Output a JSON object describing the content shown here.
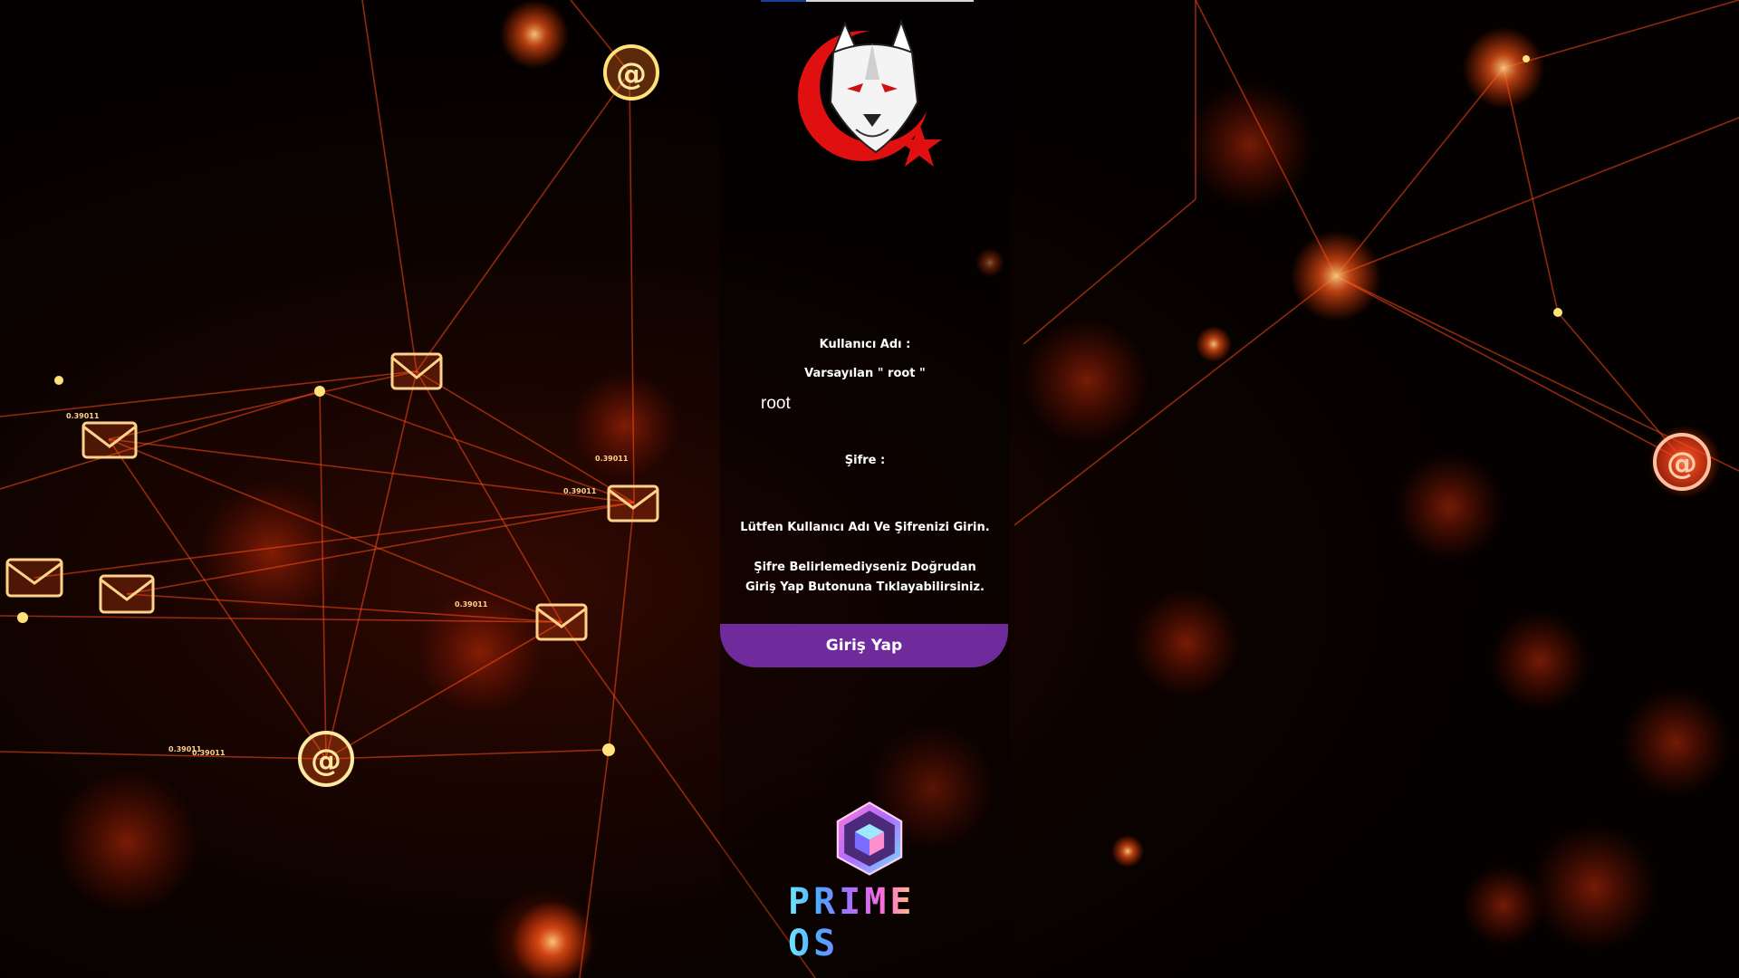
{
  "login": {
    "username_label": "Kullanıcı Adı :",
    "username_hint": "Varsayılan \" root \"",
    "username_value": "root",
    "password_label": "Şifre :",
    "password_value": "",
    "info_line1": "Lütfen Kullanıcı Adı Ve Şifrenizi Girin.",
    "info_line2": "Şifre Belirlemediyseniz Doğrudan Giriş Yap Butonuna Tıklayabilirsiniz.",
    "login_button": "Giriş Yap"
  },
  "brand": {
    "name": "PRIME OS"
  },
  "background": {
    "labels": [
      "0.39011",
      "0.39011",
      "0.39011",
      "0.39011",
      "0.39011",
      "0.39011"
    ]
  },
  "colors": {
    "button": "#6f2a9b",
    "accent_red": "#e01010",
    "glow_orange": "#ff5a1a",
    "text": "#ffffff"
  },
  "icons": [
    "wolf-logo",
    "envelope-icon",
    "at-sign-icon",
    "prime-os-cube-icon"
  ]
}
